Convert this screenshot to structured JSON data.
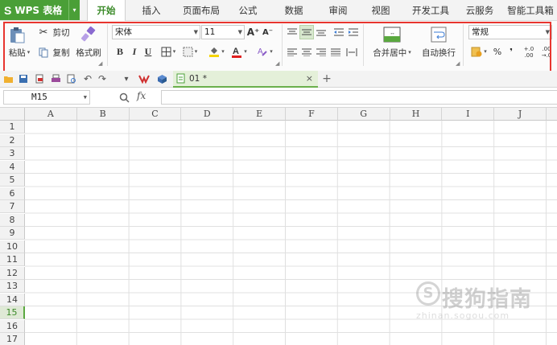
{
  "app": {
    "logo": "S",
    "name": "WPS 表格",
    "caret": "▾"
  },
  "menu": {
    "tabs": [
      "开始",
      "插入",
      "页面布局",
      "公式",
      "数据",
      "审阅",
      "视图",
      "开发工具",
      "云服务",
      "智能工具箱"
    ],
    "active_index": 0
  },
  "ribbon": {
    "paste_label": "粘贴",
    "cut_label": "剪切",
    "copy_label": "复制",
    "format_painter_label": "格式刷",
    "font_name": "宋体",
    "font_size": "11",
    "font_grow": "A⁺",
    "font_shrink": "A⁻",
    "bold": "B",
    "italic": "I",
    "underline": "U",
    "merge_center_label": "合并居中",
    "wrap_text_label": "自动换行",
    "number_format": "常规",
    "percent": "%",
    "thousands": "❜",
    "inc_decimal": "+.0 .00",
    "dec_decimal": ".00 →.0",
    "accent_color": "#4a9f37",
    "highlight_color": "#e8352f"
  },
  "document": {
    "tab_name": "01 *",
    "close": "×",
    "new_tab": "+"
  },
  "formula_bar": {
    "name_box": "M15",
    "fx": "fx",
    "formula": ""
  },
  "grid": {
    "columns": [
      "A",
      "B",
      "C",
      "D",
      "E",
      "F",
      "G",
      "H",
      "I",
      "J"
    ],
    "rows": [
      "1",
      "2",
      "3",
      "4",
      "5",
      "6",
      "7",
      "8",
      "9",
      "10",
      "11",
      "12",
      "13",
      "14",
      "15",
      "16",
      "17"
    ],
    "selected_row": "15"
  },
  "watermark": {
    "icon": "S",
    "text": "搜狗指南",
    "url": "zhinan.sogou.com"
  }
}
